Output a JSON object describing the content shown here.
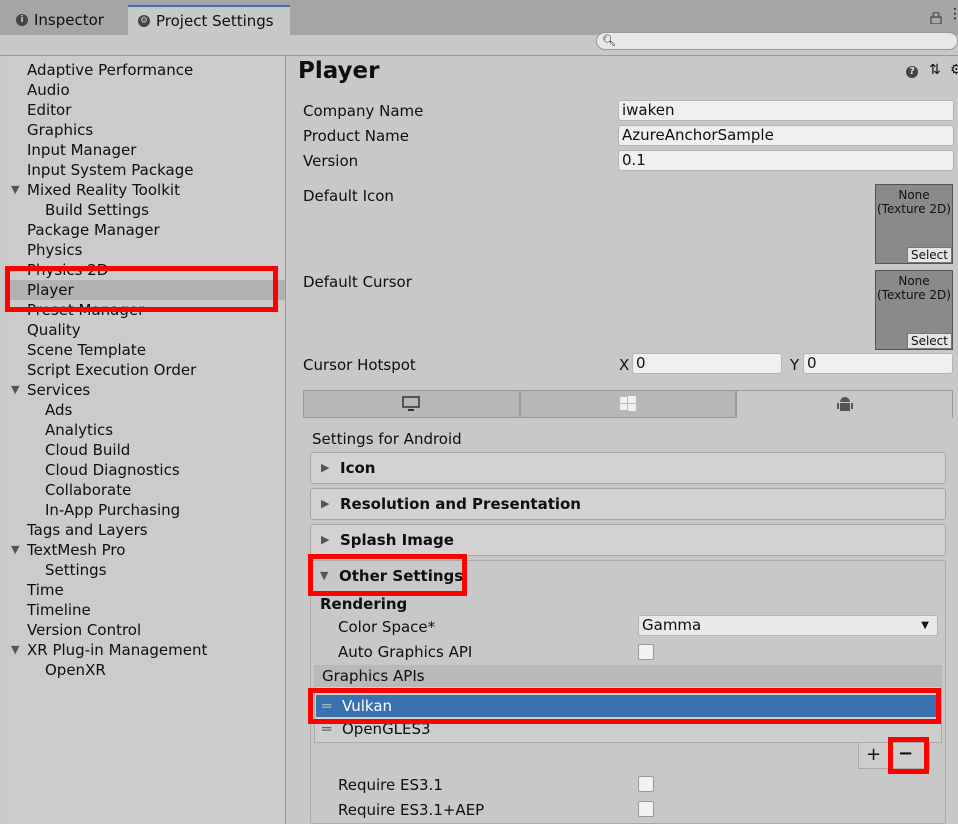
{
  "tabs": {
    "inspector": "Inspector",
    "project_settings": "Project Settings"
  },
  "search": {
    "placeholder": ""
  },
  "sidebar": {
    "items": [
      {
        "label": "Adaptive Performance",
        "indent": 0
      },
      {
        "label": "Audio",
        "indent": 0
      },
      {
        "label": "Editor",
        "indent": 0
      },
      {
        "label": "Graphics",
        "indent": 0
      },
      {
        "label": "Input Manager",
        "indent": 0
      },
      {
        "label": "Input System Package",
        "indent": 0
      },
      {
        "label": "Mixed Reality Toolkit",
        "indent": 0,
        "expanded": true
      },
      {
        "label": "Build Settings",
        "indent": 1
      },
      {
        "label": "Package Manager",
        "indent": 0
      },
      {
        "label": "Physics",
        "indent": 0
      },
      {
        "label": "Physics 2D",
        "indent": 0
      },
      {
        "label": "Player",
        "indent": 0,
        "selected": true
      },
      {
        "label": "Preset Manager",
        "indent": 0
      },
      {
        "label": "Quality",
        "indent": 0
      },
      {
        "label": "Scene Template",
        "indent": 0
      },
      {
        "label": "Script Execution Order",
        "indent": 0
      },
      {
        "label": "Services",
        "indent": 0,
        "expanded": true
      },
      {
        "label": "Ads",
        "indent": 1
      },
      {
        "label": "Analytics",
        "indent": 1
      },
      {
        "label": "Cloud Build",
        "indent": 1
      },
      {
        "label": "Cloud Diagnostics",
        "indent": 1
      },
      {
        "label": "Collaborate",
        "indent": 1
      },
      {
        "label": "In-App Purchasing",
        "indent": 1
      },
      {
        "label": "Tags and Layers",
        "indent": 0
      },
      {
        "label": "TextMesh Pro",
        "indent": 0,
        "expanded": true
      },
      {
        "label": "Settings",
        "indent": 1
      },
      {
        "label": "Time",
        "indent": 0
      },
      {
        "label": "Timeline",
        "indent": 0
      },
      {
        "label": "Version Control",
        "indent": 0
      },
      {
        "label": "XR Plug-in Management",
        "indent": 0,
        "expanded": true
      },
      {
        "label": "OpenXR",
        "indent": 1
      }
    ]
  },
  "main": {
    "title": "Player",
    "company_label": "Company Name",
    "company_value": "iwaken",
    "product_label": "Product Name",
    "product_value": "AzureAnchorSample",
    "version_label": "Version",
    "version_value": "0.1",
    "default_icon_label": "Default Icon",
    "default_cursor_label": "Default Cursor",
    "texture_none": "None",
    "texture_type": "(Texture 2D)",
    "texture_select": "Select",
    "hotspot_label": "Cursor Hotspot",
    "hotspot_x_label": "X",
    "hotspot_x": "0",
    "hotspot_y_label": "Y",
    "hotspot_y": "0",
    "settings_for": "Settings for Android",
    "foldouts": {
      "icon": "Icon",
      "resolution": "Resolution and Presentation",
      "splash": "Splash Image",
      "other": "Other Settings"
    },
    "rendering": "Rendering",
    "color_space_label": "Color Space*",
    "color_space_value": "Gamma",
    "auto_graphics_label": "Auto Graphics API",
    "graphics_apis_label": "Graphics APIs",
    "api_list": [
      "Vulkan",
      "OpenGLES3"
    ],
    "add_button": "+",
    "remove_button": "−",
    "require_es31": "Require ES3.1",
    "require_es31_aep": "Require ES3.1+AEP"
  },
  "colors": {
    "highlight": "#ff0000",
    "selection": "#3a72b0"
  }
}
